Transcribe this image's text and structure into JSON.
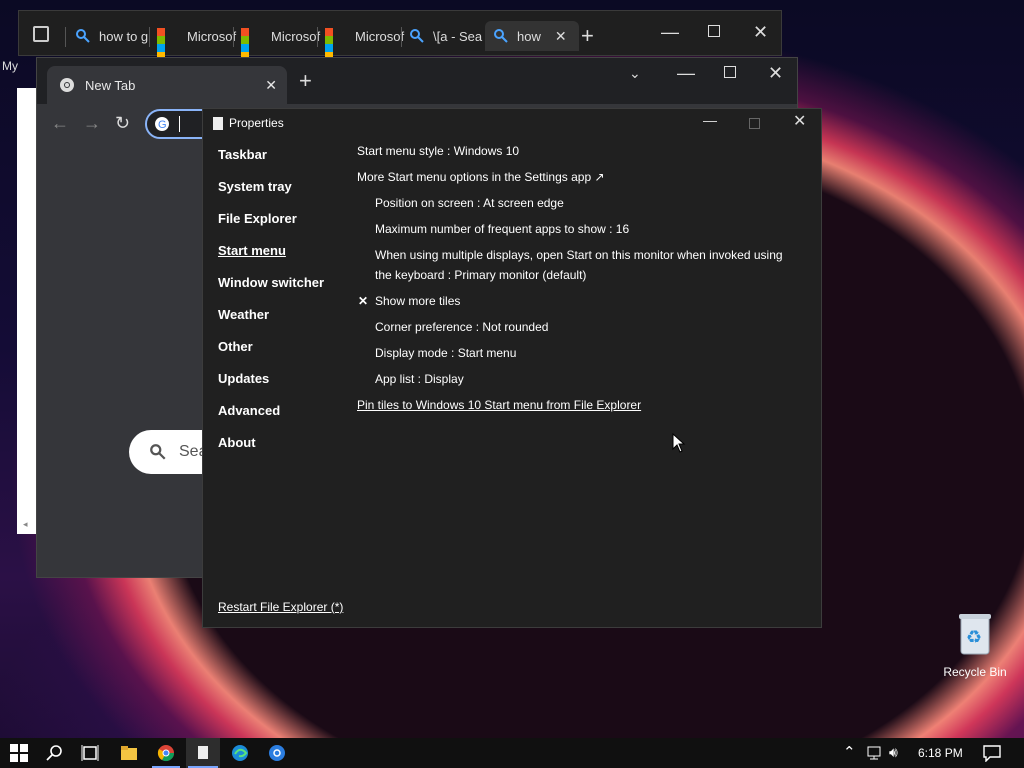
{
  "desktop": {
    "recycle_bin_label": "Recycle Bin",
    "partial_label": "My"
  },
  "back_browser": {
    "tabs": [
      {
        "label": "how to g",
        "icon": "search-icon"
      },
      {
        "label": "Microsof",
        "icon": "microsoft-logo-icon"
      },
      {
        "label": "Microsof",
        "icon": "microsoft-logo-icon"
      },
      {
        "label": "Microsof",
        "icon": "microsoft-logo-icon"
      },
      {
        "label": "\\[a - Sea",
        "icon": "search-icon"
      },
      {
        "label": "how",
        "icon": "search-icon"
      }
    ]
  },
  "front_browser": {
    "tab_title": "New Tab",
    "search_placeholder": "Sea"
  },
  "properties": {
    "title": "Properties",
    "nav": [
      {
        "label": "Taskbar"
      },
      {
        "label": "System tray"
      },
      {
        "label": "File Explorer"
      },
      {
        "label": "Start menu"
      },
      {
        "label": "Window switcher"
      },
      {
        "label": "Weather"
      },
      {
        "label": "Other"
      },
      {
        "label": "Updates"
      },
      {
        "label": "Advanced"
      },
      {
        "label": "About"
      }
    ],
    "active_nav": "Start menu",
    "options": {
      "start_menu_style": "Start menu style : Windows 10",
      "more_options": "More Start menu options in the Settings app ↗",
      "position": "Position on screen : At screen edge",
      "max_frequent": "Maximum number of frequent apps to show : 16",
      "multi_display_line1": "When using multiple displays, open Start on this monitor when invoked using",
      "multi_display_line2": "the keyboard : Primary monitor (default)",
      "show_more_tiles_mark": "✕",
      "show_more_tiles": "Show more tiles",
      "corner_pref": "Corner preference : Not rounded",
      "display_mode": "Display mode : Start menu",
      "app_list": "App list : Display",
      "pin_tiles": "Pin tiles to Windows 10 Start menu from File Explorer"
    },
    "restart_link": "Restart File Explorer (*)"
  },
  "taskbar": {
    "time": "6:18 PM"
  },
  "colors": {
    "accent": "#7aa6ff",
    "dialog_bg": "#202020",
    "taskbar_bg": "#101010"
  }
}
